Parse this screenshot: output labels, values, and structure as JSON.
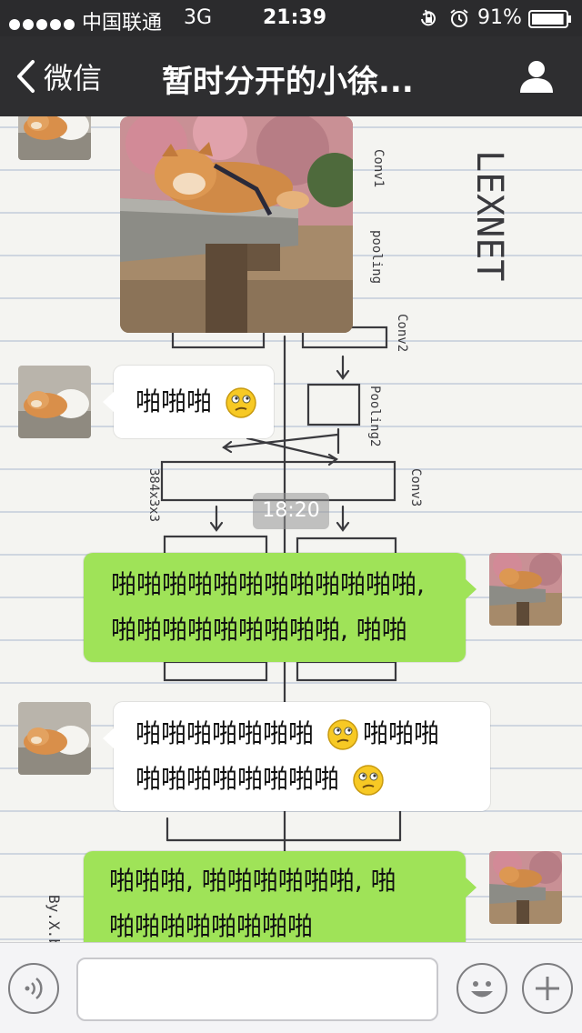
{
  "status_bar": {
    "carrier": "中国联通",
    "network": "3G",
    "time": "21:39",
    "battery_percent": "91%",
    "battery_level": 0.91,
    "signal_dots": 5,
    "icons": [
      "signal-dots-icon",
      "rotation-lock-icon",
      "alarm-icon",
      "battery-icon"
    ]
  },
  "nav": {
    "back_label": "微信",
    "title": "暂时分开的小徐...",
    "icons": [
      "chevron-left-icon",
      "profile-icon"
    ]
  },
  "chat": {
    "timestamp": "18:20",
    "messages": [
      {
        "side": "left",
        "type": "image",
        "subject": "shiba-inu-sleeping-on-bench"
      },
      {
        "side": "left",
        "type": "text",
        "lines": [
          "啪啪啪"
        ],
        "emoji": "confused-face-emoji"
      },
      {
        "side": "right",
        "type": "text",
        "lines": [
          "啪啪啪啪啪啪啪啪啪啪啪啪,",
          "啪啪啪啪啪啪啪啪啪, 啪啪"
        ]
      },
      {
        "side": "left",
        "type": "text",
        "lines": [
          "啪啪啪啪啪啪啪",
          "啪啪啪",
          "啪啪啪啪啪啪啪啪"
        ],
        "emoji": "confused-face-emoji"
      },
      {
        "side": "right",
        "type": "text",
        "lines": [
          "啪啪啪, 啪啪啪啪啪啪, 啪",
          "啪啪啪啪啪啪啪啪"
        ]
      }
    ]
  },
  "background": {
    "notes": [
      "LEXNET",
      "Conv1",
      "pooling",
      "Conv2",
      "Pooling2",
      "Conv3",
      "384x3x3",
      "By.X.bb"
    ]
  },
  "input_bar": {
    "placeholder": "",
    "icons": [
      "voice-icon",
      "emoji-face-icon",
      "plus-icon"
    ]
  },
  "colors": {
    "nav_bg": "#2e2e30",
    "status_bg": "#2b2b2d",
    "bubble_green": "#9fe358",
    "bubble_white": "#ffffff",
    "input_bg": "#f4f4f6"
  }
}
